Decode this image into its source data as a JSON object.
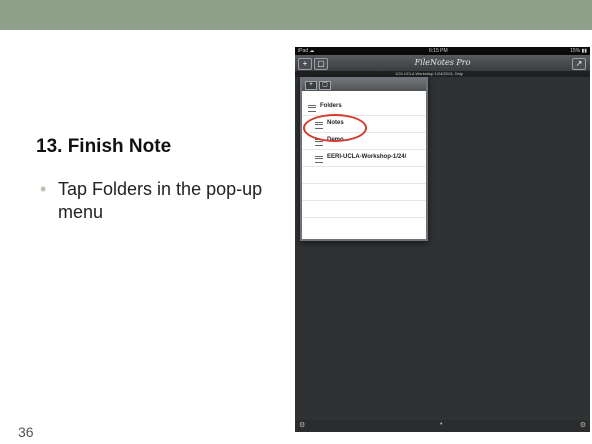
{
  "slide": {
    "title": "13. Finish Note",
    "bullet_marker": "•",
    "bullet": "Tap Folders in the pop-up menu",
    "page_number": "36"
  },
  "ipad": {
    "status_left": "iPad ☁",
    "status_time": "6:15 PM",
    "status_right": "15% ▮▮",
    "nav_plus": "+",
    "nav_box": "▢",
    "app_title": "FileNotes Pro",
    "nav_export": "↗",
    "subtitle": "1/24 UCLA Workshop 1/24/2013, Only",
    "popover": {
      "btn_plus": "+",
      "btn_box": "▢",
      "items": [
        "Folders",
        "Notes",
        "Demo",
        "EERI-UCLA-Workshop-1/24/"
      ]
    },
    "bottom_left": "⚙",
    "bottom_center": "•",
    "bottom_right": "⚙"
  },
  "colors": {
    "header": "#8ea08a",
    "circle": "#d23a2c",
    "bullet_dot": "#b7c3b3"
  }
}
